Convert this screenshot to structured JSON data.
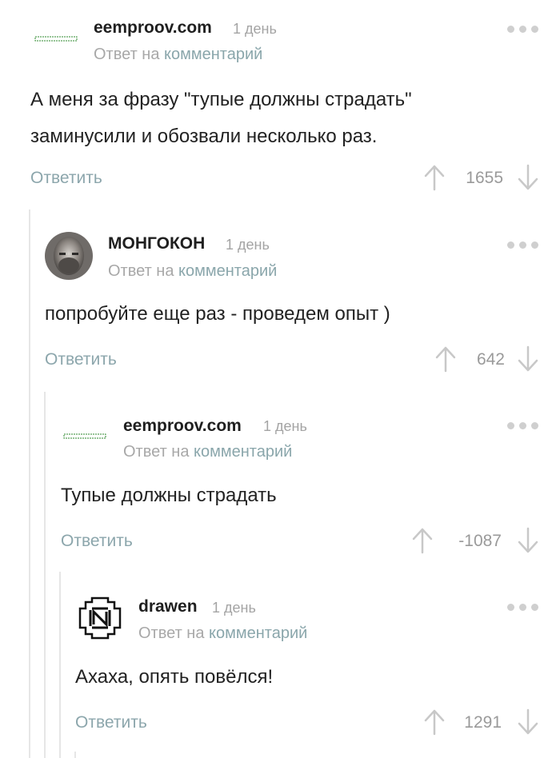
{
  "reply_label": "Ответить",
  "reply_to_prefix": "Ответ на",
  "reply_to_link": "комментарий",
  "comments": [
    {
      "user": "eemproov.com",
      "time": "1 день",
      "text_lines": [
        "А меня за фразу \"тупые должны страдать\"",
        "заминусили и обозвали несколько раз."
      ],
      "score": "1655"
    },
    {
      "user": "МОНГОКОН",
      "time": "1 день",
      "text_lines": [
        "попробуйте еще раз - проведем опыт )"
      ],
      "score": "642"
    },
    {
      "user": "eemproov.com",
      "time": "1 день",
      "text_lines": [
        "Тупые должны страдать"
      ],
      "score": "-1087"
    },
    {
      "user": "drawen",
      "time": "1 день",
      "text_lines": [
        "Ахаха, опять повёлся!"
      ],
      "score": "1291"
    }
  ],
  "colors": {
    "link": "#8ca6ac",
    "muted": "#a4a4a4",
    "thread": "#e6e6e6"
  }
}
